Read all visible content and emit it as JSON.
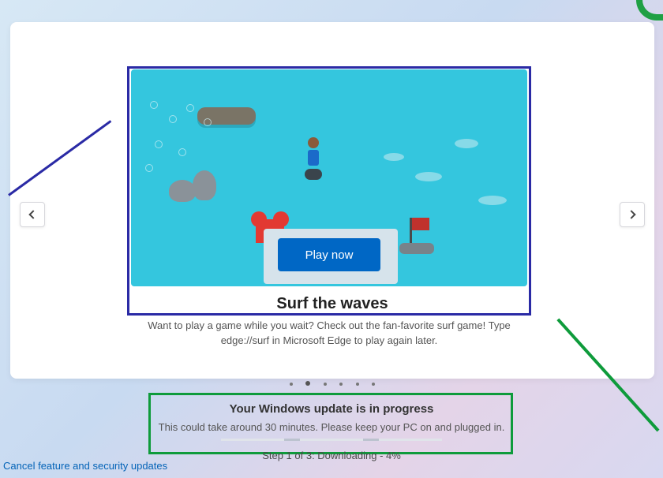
{
  "carousel": {
    "play_label": "Play now",
    "title": "Surf the waves",
    "description": "Want to play a game while you wait? Check out the fan-favorite surf game! Type edge://surf in Microsoft Edge to play again later.",
    "active_index": 1,
    "dot_count": 6
  },
  "status": {
    "headline": "Your Windows update is in progress",
    "subline": "This could take around 30 minutes. Please keep your PC on and plugged in.",
    "step_text": "Step 1 of 3: Downloading - 4%"
  },
  "links": {
    "cancel": "Cancel feature and security updates"
  }
}
